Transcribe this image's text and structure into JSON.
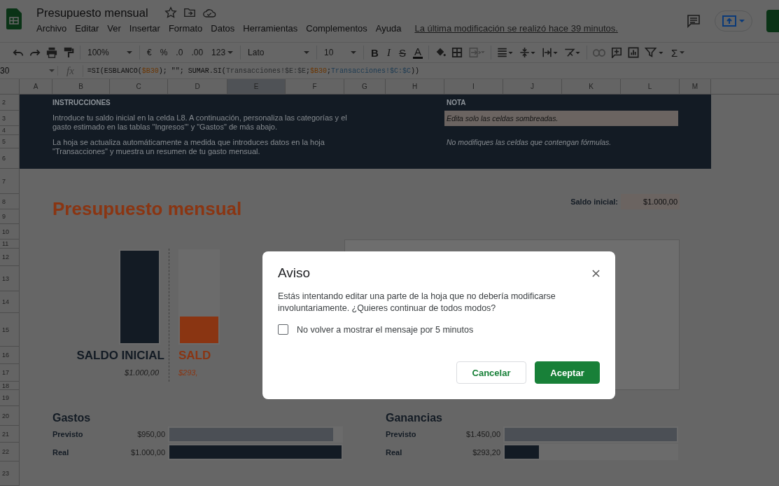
{
  "document": {
    "title": "Presupuesto mensual",
    "menu": [
      "Archivo",
      "Editar",
      "Ver",
      "Insertar",
      "Formato",
      "Datos",
      "Herramientas",
      "Complementos",
      "Ayuda"
    ],
    "last_edit": "La última modificación se realizó hace 39 minutos."
  },
  "toolbar": {
    "zoom": "100%",
    "currency": "€",
    "percent": "%",
    "decrease_decimals": ".0",
    "increase_decimals": ".00",
    "number_format": "123",
    "font": "Lato",
    "font_size": "10",
    "bold": "B",
    "italic": "I",
    "strikethrough": "S",
    "text_color": "A",
    "merge_cells": {
      "disabled": true
    },
    "insert_link": {
      "disabled": true
    },
    "functions": "Σ"
  },
  "formula_bar": {
    "cell": "30",
    "fx": "fx",
    "formula": [
      {
        "text": "=SI(ESBLANCO("
      },
      {
        "text": "$B30",
        "color": "#6b3500"
      },
      {
        "text": "); \"\"; SUMAR.SI("
      },
      {
        "text": "Transacciones!$E:$E",
        "color": "#2a2c2e"
      },
      {
        "text": ";"
      },
      {
        "text": "$B30",
        "color": "#6b3500"
      },
      {
        "text": ";"
      },
      {
        "text": "Transacciones!$C:$C",
        "color": "#1c3a52"
      },
      {
        "text": "))"
      }
    ]
  },
  "columns": [
    {
      "label": "A",
      "selected": false
    },
    {
      "label": "B",
      "selected": false
    },
    {
      "label": "C",
      "selected": false
    },
    {
      "label": "D",
      "selected": false
    },
    {
      "label": "E",
      "selected": true
    },
    {
      "label": "F",
      "selected": false
    },
    {
      "label": "G",
      "selected": false
    },
    {
      "label": "H",
      "selected": false
    },
    {
      "label": "I",
      "selected": false
    },
    {
      "label": "J",
      "selected": false
    },
    {
      "label": "K",
      "selected": false
    },
    {
      "label": "L",
      "selected": false
    },
    {
      "label": "M",
      "selected": false
    }
  ],
  "rows": [
    "2",
    "3",
    "4",
    "5",
    "6",
    "7",
    "8",
    "9",
    "10",
    "11",
    "12",
    "13",
    "14",
    "15",
    "16",
    "17",
    "18",
    "19",
    "20",
    "21",
    "22",
    "23"
  ],
  "instructions": {
    "title": "INSTRUCCIONES",
    "paragraphs": [
      "Introduce tu saldo inicial en la celda L8. A continuación, personaliza las categorías y el gasto estimado en las tablas \"Ingresos\"' y \"Gastos\" de más abajo.",
      "La hoja se actualiza automáticamente a medida que introduces datos en la hoja \"Transacciones\" y muestra un resumen de tu gasto mensual."
    ]
  },
  "note": {
    "title": "NOTA",
    "lines": [
      "Edita solo las celdas sombreadas.",
      "No modifiques las celdas que contengan fórmulas."
    ]
  },
  "sheet_title": "Presupuesto mensual",
  "starting_balance": {
    "label": "Saldo inicial:",
    "value": "$1.000,00"
  },
  "balance_chart": [
    {
      "label": "SALDO INICIAL",
      "amount": "$1.000,00",
      "level": 1,
      "color": "#131b24"
    },
    {
      "label": "SALD",
      "amount": "$293,",
      "level": 0.29,
      "color": "#8a3512"
    }
  ],
  "summaries": [
    {
      "title": "Gastos",
      "rows": [
        {
          "label": "Previsto",
          "amount": "$950,00",
          "level": 0.95,
          "kind": "planned"
        },
        {
          "label": "Real",
          "amount": "$1.000,00",
          "level": 1,
          "kind": "actual"
        }
      ]
    },
    {
      "title": "Ganancias",
      "rows": [
        {
          "label": "Previsto",
          "amount": "$1.450,00",
          "level": 1,
          "kind": "planned"
        },
        {
          "label": "Real",
          "amount": "$293,20",
          "level": 0.2,
          "kind": "actual"
        }
      ]
    }
  ],
  "dialog": {
    "title": "Aviso",
    "message": "Estás intentando editar una parte de la hoja que no debería modificarse involuntariamente. ¿Quieres continuar de todos modos?",
    "checkbox": {
      "label": "No volver a mostrar el mensaje por 5 minutos",
      "checked": false
    },
    "buttons": [
      {
        "label": "Cancelar",
        "kind": "secondary"
      },
      {
        "label": "Aceptar",
        "kind": "primary"
      }
    ]
  }
}
